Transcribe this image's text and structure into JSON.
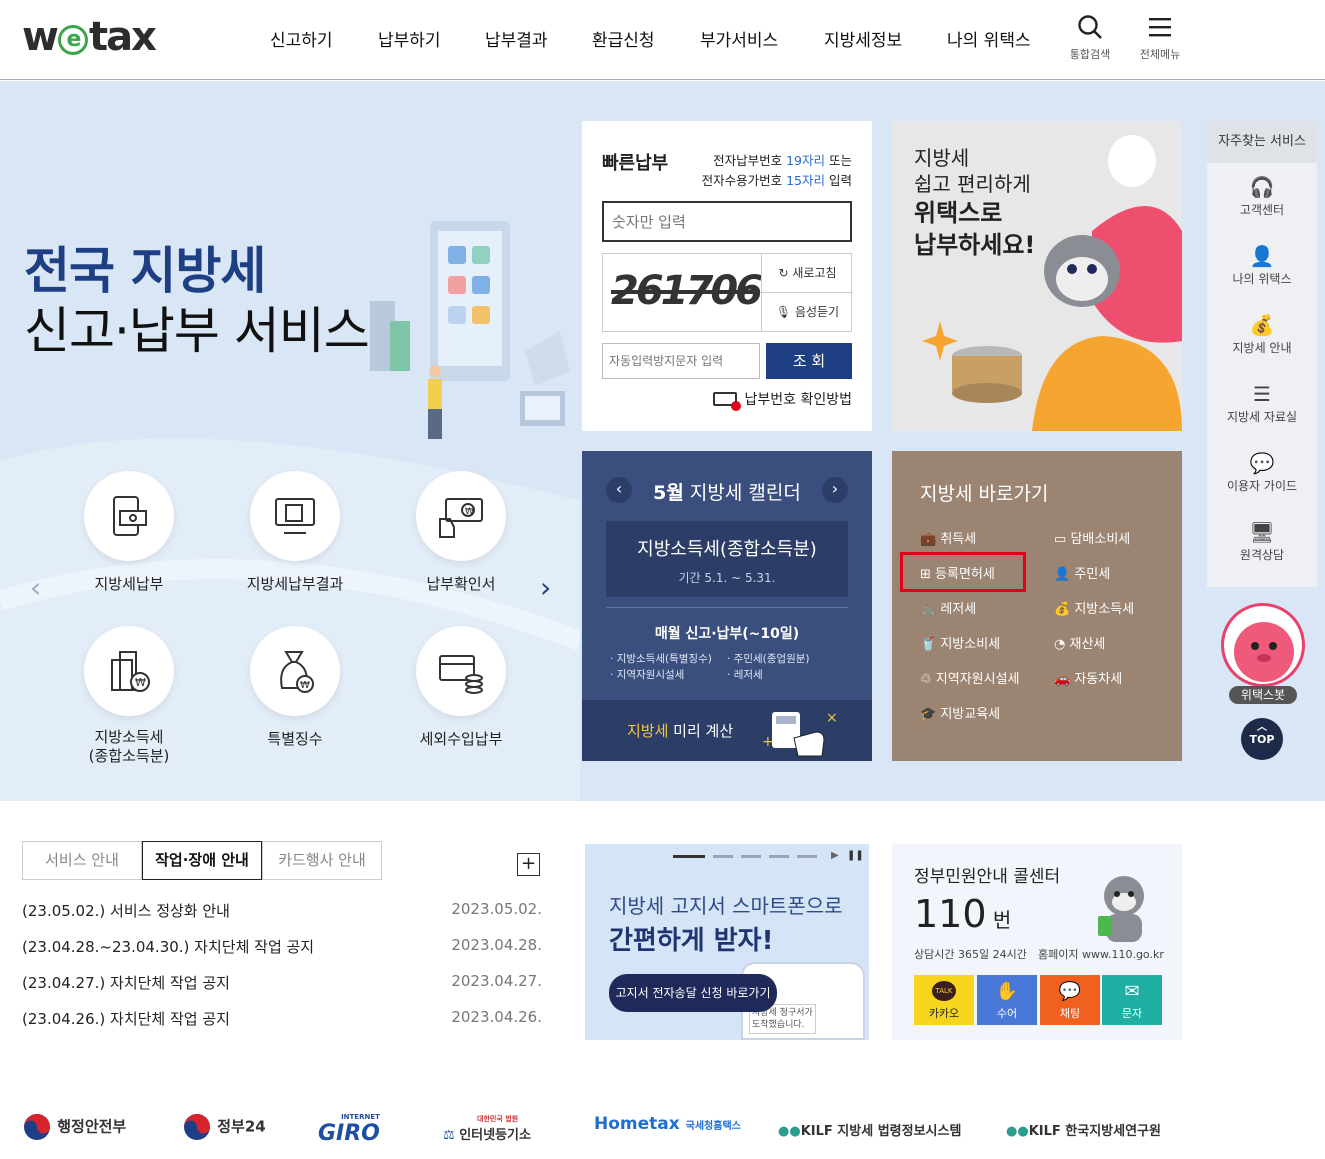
{
  "header": {
    "logo": {
      "pre": "w",
      "e": "e",
      "post": "tax"
    },
    "nav": [
      "신고하기",
      "납부하기",
      "납부결과",
      "환급신청",
      "부가서비스",
      "지방세정보",
      "나의 위택스"
    ],
    "search_label": "통합검색",
    "menu_label": "전체메뉴"
  },
  "hero": {
    "title1": "전국 지방세",
    "title2": "신고·납부 서비스",
    "services": [
      {
        "label": "지방세납부",
        "icon": "tax-payment-icon"
      },
      {
        "label": "지방세납부결과",
        "icon": "payment-result-icon"
      },
      {
        "label": "납부확인서",
        "icon": "payment-certificate-icon"
      },
      {
        "label": "지방소득세\n(종합소득분)",
        "icon": "income-tax-icon"
      },
      {
        "label": "특별징수",
        "icon": "special-collection-icon"
      },
      {
        "label": "세외수입납부",
        "icon": "non-tax-revenue-icon"
      }
    ]
  },
  "quickpay": {
    "title": "빠른납부",
    "desc1_pre": "전자납부번호 ",
    "desc1_hl": "19자리",
    "desc1_post": " 또는",
    "desc2_pre": "전자수용가번호 ",
    "desc2_hl": "15자리",
    "desc2_post": " 입력",
    "input_placeholder": "숫자만 입력",
    "captcha": "261706",
    "refresh": "새로고침",
    "listen": "음성듣기",
    "captcha_placeholder": "자동입력방지문자 입력",
    "submit": "조 회",
    "howto": "납부번호 확인방법"
  },
  "calendar": {
    "month": "5월",
    "title": "지방세 캘린더",
    "event": "지방소득세(종합소득분)",
    "period": "기간 5.1. ~ 5.31.",
    "monthly": "매월 신고·납부(~10일)",
    "items": [
      "지방소득세(특별징수)",
      "주민세(종업원분)",
      "지역자원시설세",
      "레저세"
    ],
    "calc_hl": "지방세",
    "calc": " 미리 계산"
  },
  "promo": {
    "line1": "지방세",
    "line2": "쉽고 편리하게",
    "line3": "위택스로",
    "line4": "납부하세요!"
  },
  "shortcut": {
    "title": "지방세 바로가기",
    "left": [
      "취득세",
      "등록면허세",
      "레저세",
      "지방소비세",
      "지역자원시설세",
      "지방교육세"
    ],
    "right": [
      "담배소비세",
      "주민세",
      "지방소득세",
      "재산세",
      "자동차세"
    ]
  },
  "side": {
    "title": "자주찾는 서비스",
    "items": [
      "고객센터",
      "나의 위택스",
      "지방세 안내",
      "지방세 자료실",
      "이용자 가이드",
      "원격상담"
    ],
    "bot": "위택스봇",
    "top": "TOP"
  },
  "notice": {
    "tabs": [
      "서비스 안내",
      "작업·장애 안내",
      "카드행사 안내"
    ],
    "active_tab": 1,
    "items": [
      {
        "title": "(23.05.02.) 서비스 정상화 안내",
        "date": "2023.05.02."
      },
      {
        "title": "(23.04.28.~23.04.30.) 자치단체 작업 공지",
        "date": "2023.04.28."
      },
      {
        "title": "(23.04.27.) 자치단체 작업 공지",
        "date": "2023.04.27."
      },
      {
        "title": "(23.04.26.) 자치단체 작업 공지",
        "date": "2023.04.26."
      }
    ]
  },
  "banner": {
    "line1": "지방세 고지서 스마트폰으로",
    "line2": "간편하게 받자!",
    "button": "고지서 전자송달 신청 바로가기",
    "phone_text1": "지방세 청구서가",
    "phone_text2": "도착했습니다."
  },
  "callcenter": {
    "title": "정부민원안내 콜센터",
    "number": "110",
    "unit": "번",
    "hours": "상담시간 365일 24시간",
    "home": "홈페이지 www.110.go.kr",
    "buttons": [
      {
        "label": "카카오",
        "color": "#f7d51d"
      },
      {
        "label": "수어",
        "color": "#4a78d6"
      },
      {
        "label": "채팅",
        "color": "#f0601e"
      },
      {
        "label": "문자",
        "color": "#1eaea2"
      }
    ],
    "talk": "TALK"
  },
  "footer": [
    "행정안전부",
    "정부24",
    "GIRO",
    "인터넷등기소",
    "Hometax",
    "KILF 지방세 법령정보시스템",
    "KILF 한국지방세연구원"
  ],
  "footer_small": {
    "giro_top": "INTERNET",
    "iros_top": "대한민국 법원",
    "hometax_sub": "국세청홈택스"
  },
  "colors": {
    "navy": "#1f3f85",
    "accent_blue": "#2a6bd0",
    "highlight_red": "#e0001b",
    "calendar_bg": "#3b4f7f",
    "shortcut_bg": "#9b8471"
  }
}
